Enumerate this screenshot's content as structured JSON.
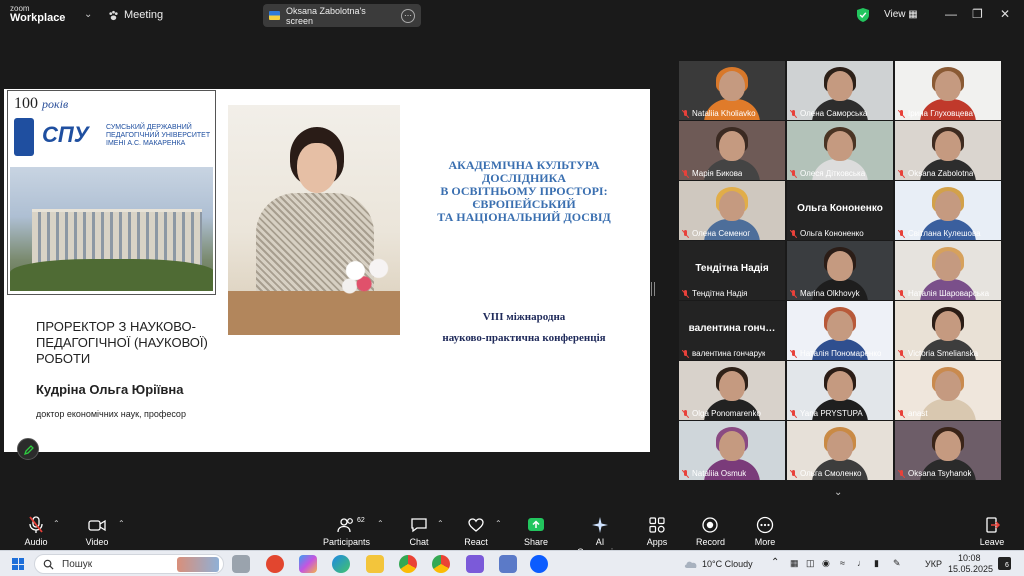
{
  "titlebar": {
    "logo_small": "zoom",
    "logo_big": "Workplace",
    "meeting_label": "Meeting",
    "screen_share_label": "Oksana Zabolotna's screen",
    "view_label": "View",
    "window_controls": [
      "minimize",
      "maximize",
      "close"
    ]
  },
  "slide": {
    "years_number": "100",
    "years_word": "років",
    "university_abbr": "СПУ",
    "university_name": "СУМСЬКИЙ ДЕРЖАВНИЙ ПЕДАГОГІЧНИЙ УНІВЕРСИТЕТ ІМЕНІ А.С. МАКАРЕНКА",
    "title_lines": [
      "АКАДЕМІЧНА КУЛЬТУРА",
      "ДОСЛІДНИКА",
      "В ОСВІТНЬОМУ ПРОСТОРІ:",
      "ЄВРОПЕЙСЬКИЙ",
      "ТА НАЦІОНАЛЬНИЙ ДОСВІД"
    ],
    "conference_lines": [
      "VIII міжнародна",
      "науково-практична конференція"
    ],
    "role_lines": [
      "ПРОРЕКТОР З НАУКОВО-",
      "ПЕДАГОГІЧНОЇ (НАУКОВОЇ)",
      "РОБОТИ"
    ],
    "person_name": "Кудріна Ольга Юріївна",
    "degree": "доктор економічних наук, професор"
  },
  "participants": [
    {
      "name": "Nataliia Kholiavko",
      "big_name": "",
      "bg": "#3a3a3a",
      "hair": "#d8782a",
      "shirt": "#e07b2a",
      "active": false
    },
    {
      "name": "Олена Саморська",
      "big_name": "",
      "bg": "#cfd2d3",
      "hair": "#2c2018",
      "shirt": "#2d2d2d",
      "active": false
    },
    {
      "name": "Ірина Глуховцева",
      "big_name": "",
      "bg": "#f1f1ef",
      "hair": "#8a5a34",
      "shirt": "#c0392b",
      "active": false
    },
    {
      "name": "Марія Бикова",
      "big_name": "",
      "bg": "#6e5a56",
      "hair": "#3b2a22",
      "shirt": "#444",
      "active": false
    },
    {
      "name": "Олеся Дітковська",
      "big_name": "",
      "bg": "#b3c2b9",
      "hair": "#4a3424",
      "shirt": "#dcdcdc",
      "active": false
    },
    {
      "name": "Oksana Zabolotna",
      "big_name": "",
      "bg": "#dad5cf",
      "hair": "#3e2b20",
      "shirt": "#2d2d2d",
      "active": false
    },
    {
      "name": "Олена Семеног",
      "big_name": "",
      "bg": "#cfc8bf",
      "hair": "#e1ad49",
      "shirt": "#4d6e9a",
      "active": true
    },
    {
      "name": "Ольга Кононенко",
      "big_name": "Ольга Кононенко",
      "bg": "#232323",
      "hair": "",
      "shirt": "",
      "active": false
    },
    {
      "name": "Світлана Кулешова",
      "big_name": "",
      "bg": "#e8eef6",
      "hair": "#d2a14a",
      "shirt": "#3a5f9e",
      "active": false
    },
    {
      "name": "Тендітна Надія",
      "big_name": "Тендітна Надія",
      "bg": "#232323",
      "hair": "",
      "shirt": "",
      "active": false
    },
    {
      "name": "Marina Olkhovyk",
      "big_name": "",
      "bg": "#3a3d40",
      "hair": "#2b1d17",
      "shirt": "#1e1e1e",
      "active": false
    },
    {
      "name": "Наталія Шароварська",
      "big_name": "",
      "bg": "#e6e3de",
      "hair": "#d6a15c",
      "shirt": "#7a4f8a",
      "active": false
    },
    {
      "name": "валентина гончарук",
      "big_name": "валентина  гонч…",
      "bg": "#232323",
      "hair": "",
      "shirt": "",
      "active": false
    },
    {
      "name": "Наталія Пономаренко",
      "big_name": "",
      "bg": "#eef1f7",
      "hair": "#b85a3a",
      "shirt": "#2f4f8f",
      "active": false
    },
    {
      "name": "Victoria Smelianska",
      "big_name": "",
      "bg": "#e9e1d6",
      "hair": "#2b1d16",
      "shirt": "#3d3d3d",
      "active": false
    },
    {
      "name": "Olga Ponomarenko",
      "big_name": "",
      "bg": "#d8d2cb",
      "hair": "#2f2118",
      "shirt": "#222",
      "active": false
    },
    {
      "name": "Yana PRYSTUPA",
      "big_name": "",
      "bg": "#e2e6ea",
      "hair": "#2b1d16",
      "shirt": "#1f1f1f",
      "active": false
    },
    {
      "name": "anast",
      "big_name": "",
      "bg": "#efe6dc",
      "hair": "#c98a4e",
      "shirt": "#d9c8b0",
      "active": false
    },
    {
      "name": "Nataliia Osmuk",
      "big_name": "",
      "bg": "#cfd6da",
      "hair": "#8a4a82",
      "shirt": "#7a3b7a",
      "active": false
    },
    {
      "name": "Ольга Смоленко",
      "big_name": "",
      "bg": "#e6e0d8",
      "hair": "#c98a45",
      "shirt": "#3d3d3d",
      "active": false
    },
    {
      "name": "Oksana Tsyhanok",
      "big_name": "",
      "bg": "#6d5d68",
      "hair": "#3a2418",
      "shirt": "#2a2a2a",
      "active": false
    }
  ],
  "toolbar": {
    "audio": "Audio",
    "video": "Video",
    "participants": "Participants",
    "participants_count": "62",
    "chat": "Chat",
    "react": "React",
    "share": "Share",
    "ai_companion": "AI Companion",
    "apps": "Apps",
    "record": "Record",
    "more": "More",
    "leave": "Leave"
  },
  "taskbar": {
    "search_placeholder": "Пошук",
    "weather": "10°C  Cloudy",
    "language": "УКР",
    "time": "10:08",
    "date": "15.05.2025",
    "notification_count": "6"
  },
  "colors": {
    "accent_green": "#2ecc40",
    "share_green": "#22c55e",
    "mic_off_red": "#e8413a",
    "slide_title_blue": "#3a6fb0"
  }
}
